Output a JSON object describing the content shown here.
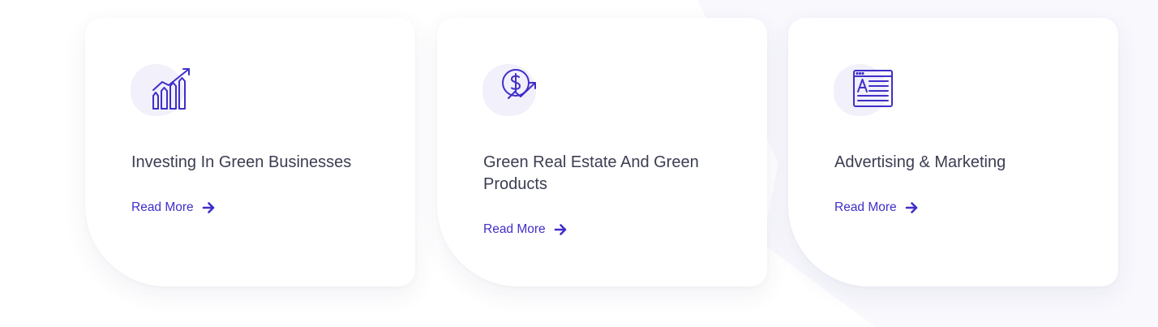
{
  "services": [
    {
      "icon": "growth-chart-icon",
      "title": "Investing In Green Businesses",
      "link_label": "Read More"
    },
    {
      "icon": "dollar-growth-icon",
      "title": "Green Real Estate And Green Products",
      "link_label": "Read More"
    },
    {
      "icon": "advertisement-browser-icon",
      "title": "Advertising & Marketing",
      "link_label": "Read More"
    }
  ],
  "colors": {
    "accent": "#3f2fc9",
    "title_text": "#3b3d52",
    "icon_blob": "#f1f0fb",
    "card_bg": "#ffffff"
  }
}
